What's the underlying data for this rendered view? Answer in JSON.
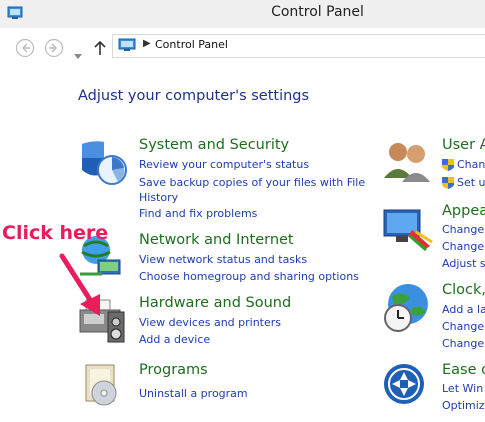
{
  "window": {
    "title": "Control Panel"
  },
  "address": {
    "path": "Control Panel"
  },
  "heading": "Adjust your computer's settings",
  "annotation": {
    "text": "Click here",
    "color": "#e91c5c"
  },
  "colors": {
    "title_green": "#1e6e1e",
    "link_blue": "#1e3cb4",
    "heading_blue": "#1e3287"
  },
  "left_categories": [
    {
      "title": "System and Security",
      "icon": "shield-icon",
      "links": [
        "Review your computer's status",
        "Save backup copies of your files with File",
        "History",
        "Find and fix problems"
      ]
    },
    {
      "title": "Network and Internet",
      "icon": "network-icon",
      "links": [
        "View network status and tasks",
        "Choose homegroup and sharing options"
      ]
    },
    {
      "title": "Hardware and Sound",
      "icon": "printer-icon",
      "links": [
        "View devices and printers",
        "Add a device"
      ]
    },
    {
      "title": "Programs",
      "icon": "programs-icon",
      "links": [
        "Uninstall a program"
      ]
    }
  ],
  "right_categories": [
    {
      "title": "User A",
      "icon": "users-icon",
      "links": [
        "Chan",
        "Set u"
      ]
    },
    {
      "title": "Appea",
      "icon": "appearance-icon",
      "links": [
        "Change",
        "Change",
        "Adjust s"
      ]
    },
    {
      "title": "Clock,",
      "icon": "globe-clock-icon",
      "links": [
        "Add a la",
        "Change",
        "Change"
      ]
    },
    {
      "title": "Ease o",
      "icon": "ease-of-access-icon",
      "links": [
        "Let Win",
        "Optimiz"
      ]
    }
  ]
}
